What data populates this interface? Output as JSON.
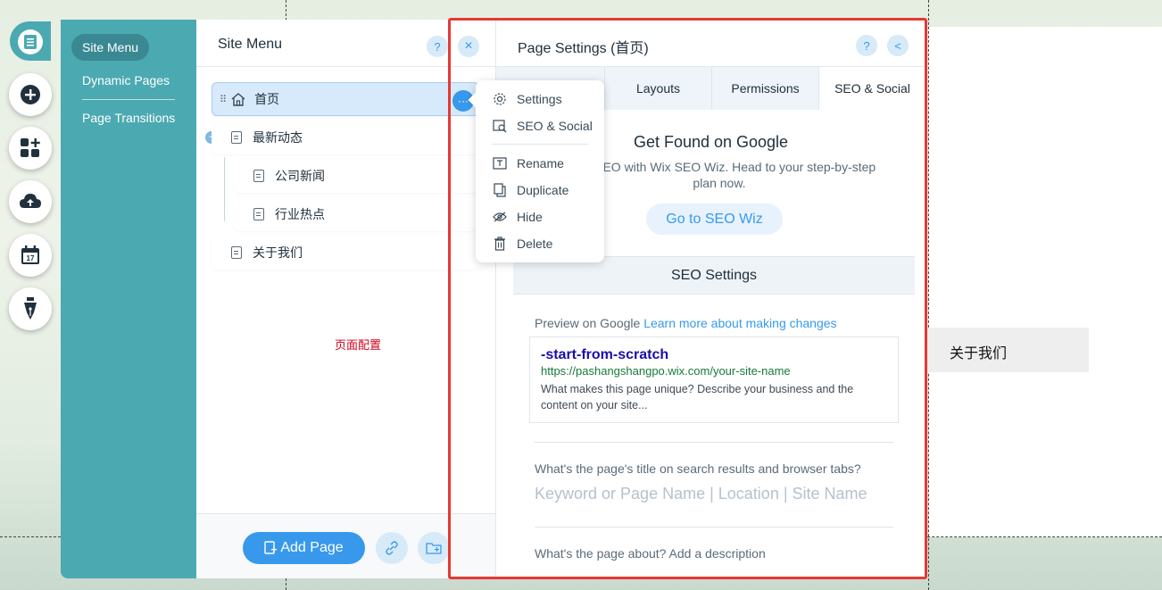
{
  "teal_nav": {
    "items": [
      {
        "label": "Site Menu"
      },
      {
        "label": "Dynamic Pages"
      },
      {
        "label": "Page Transitions"
      }
    ]
  },
  "site_menu": {
    "title": "Site Menu",
    "help_label": "?",
    "close_label": "×",
    "pages": [
      {
        "label": "首页"
      },
      {
        "label": "最新动态"
      },
      {
        "label": "公司新闻"
      },
      {
        "label": "行业热点"
      },
      {
        "label": "关于我们"
      }
    ],
    "more_label": "···",
    "collapse_label": "−",
    "note": "页面配置",
    "add_page_label": "Add Page"
  },
  "context_menu": {
    "items": [
      {
        "label": "Settings",
        "icon": "gear-icon"
      },
      {
        "label": "SEO & Social",
        "icon": "seo-search-icon"
      },
      {
        "label": "Rename",
        "icon": "rename-icon"
      },
      {
        "label": "Duplicate",
        "icon": "duplicate-icon"
      },
      {
        "label": "Hide",
        "icon": "hide-eye-icon"
      },
      {
        "label": "Delete",
        "icon": "trash-icon"
      }
    ]
  },
  "page_settings": {
    "title": "Page Settings (首页)",
    "help_label": "?",
    "back_label": "<",
    "tabs": [
      {
        "label": "Layouts"
      },
      {
        "label": "Permissions"
      },
      {
        "label": "SEO & Social"
      }
    ],
    "seo_promo_title": "Get Found on Google",
    "seo_promo_desc": "site's SEO with Wix SEO Wiz. Head to your step-by-step plan now.",
    "seo_wiz_button": "Go to SEO Wiz",
    "seo_settings_header": "SEO Settings",
    "preview_label": "Preview on Google",
    "preview_link": "Learn more about making changes",
    "google_preview": {
      "title": "-start-from-scratch",
      "url": "https://pashangshangpo.wix.com/your-site-name",
      "description": "What makes this page unique? Describe your business and the content on your site..."
    },
    "title_question": "What's the page's title on search results and browser tabs?",
    "title_placeholder": "Keyword or Page Name | Location | Site Name",
    "description_question": "What's the page about? Add a description"
  },
  "canvas": {
    "menu_label": "关于我们"
  },
  "colors": {
    "teal": "#4ba9b1",
    "accent_blue": "#3899ec",
    "highlight_red": "#e53935"
  }
}
